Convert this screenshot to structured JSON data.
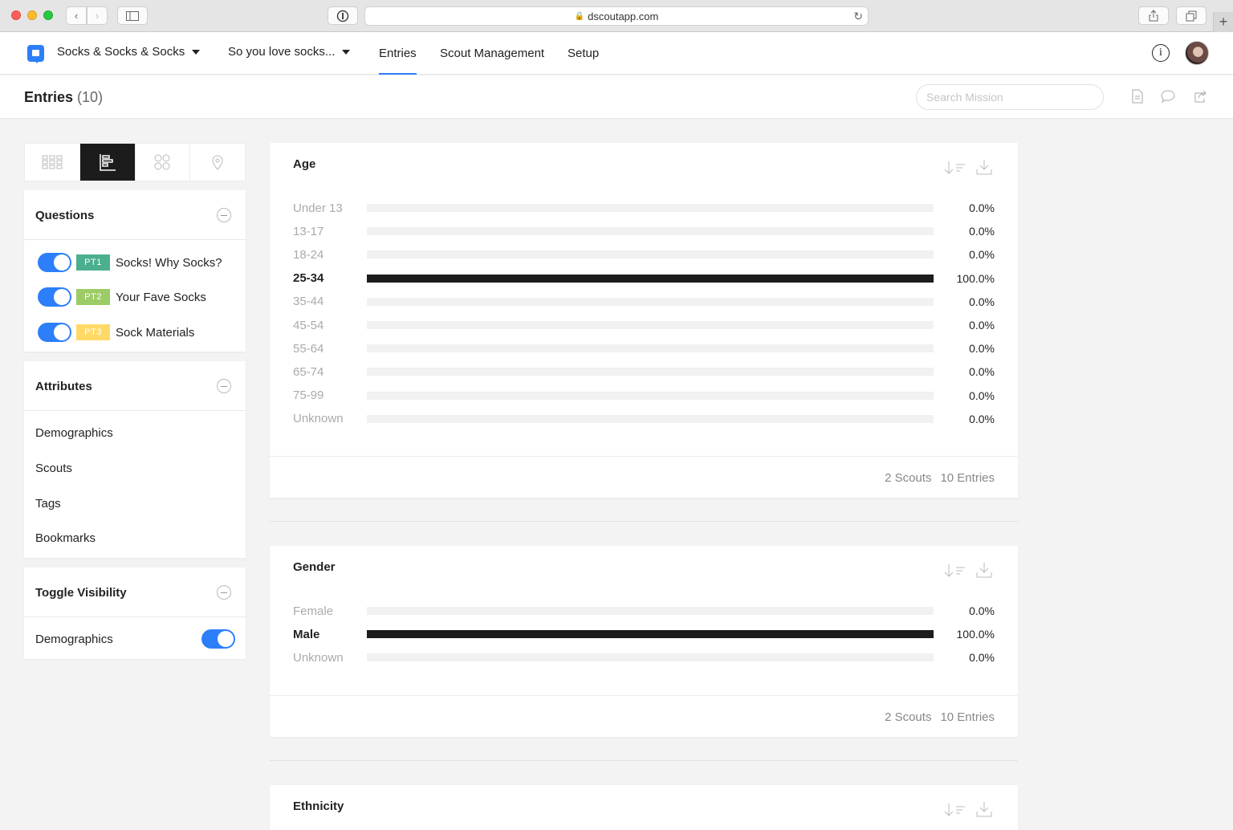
{
  "browser": {
    "url": "dscoutapp.com"
  },
  "nav": {
    "project": "Socks & Socks & Socks",
    "mission": "So you love socks...",
    "tabs": [
      "Entries",
      "Scout Management",
      "Setup"
    ],
    "active_tab": "Entries"
  },
  "header": {
    "title": "Entries",
    "count": "(10)",
    "search_placeholder": "Search Mission"
  },
  "sidebar": {
    "view_modes": [
      "grid-icon",
      "bar-chart-icon",
      "cluster-icon",
      "location-pin-icon"
    ],
    "active_view": "bar-chart-icon",
    "questions": {
      "title": "Questions",
      "items": [
        {
          "tag": "PT1",
          "label": "Socks! Why Socks?",
          "color": "#4caf8f",
          "enabled": true
        },
        {
          "tag": "PT2",
          "label": "Your Fave Socks",
          "color": "#9ccc65",
          "enabled": true
        },
        {
          "tag": "PT3",
          "label": "Sock Materials",
          "color": "#ffd966",
          "enabled": true
        }
      ]
    },
    "attributes": {
      "title": "Attributes",
      "items": [
        "Demographics",
        "Scouts",
        "Tags",
        "Bookmarks"
      ]
    },
    "toggle_visibility": {
      "title": "Toggle Visibility",
      "items": [
        {
          "label": "Demographics",
          "enabled": true
        }
      ]
    }
  },
  "chart_data": [
    {
      "type": "bar",
      "title": "Age",
      "categories": [
        "Under 13",
        "13-17",
        "18-24",
        "25-34",
        "35-44",
        "45-54",
        "55-64",
        "65-74",
        "75-99",
        "Unknown"
      ],
      "values": [
        0.0,
        0.0,
        0.0,
        100.0,
        0.0,
        0.0,
        0.0,
        0.0,
        0.0,
        0.0
      ],
      "value_labels": [
        "0.0%",
        "0.0%",
        "0.0%",
        "100.0%",
        "0.0%",
        "0.0%",
        "0.0%",
        "0.0%",
        "0.0%",
        "0.0%"
      ],
      "ylim": [
        0,
        100
      ],
      "footer": {
        "scouts": "2 Scouts",
        "entries": "10 Entries"
      }
    },
    {
      "type": "bar",
      "title": "Gender",
      "categories": [
        "Female",
        "Male",
        "Unknown"
      ],
      "values": [
        0.0,
        100.0,
        0.0
      ],
      "value_labels": [
        "0.0%",
        "100.0%",
        "0.0%"
      ],
      "ylim": [
        0,
        100
      ],
      "footer": {
        "scouts": "2 Scouts",
        "entries": "10 Entries"
      }
    },
    {
      "type": "bar",
      "title": "Ethnicity",
      "categories": [],
      "values": []
    }
  ]
}
